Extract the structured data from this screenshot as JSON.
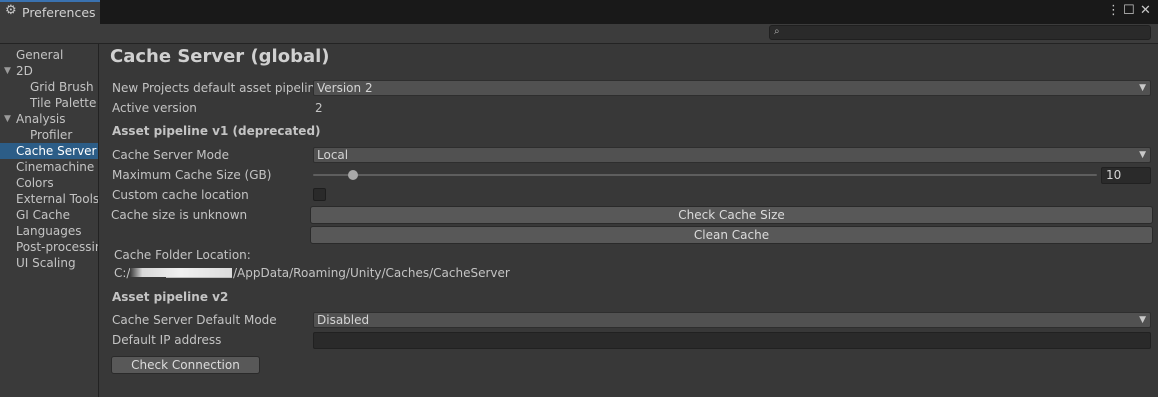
{
  "window": {
    "tab_title": "Preferences",
    "gear_icon": "gear-icon",
    "menu_icon": "⋮",
    "maximize_icon": "☐",
    "close_icon": "✕"
  },
  "search": {
    "placeholder": "",
    "value": ""
  },
  "sidebar": {
    "items": [
      {
        "label": "General",
        "indent": 0
      },
      {
        "label": "2D",
        "indent": 0,
        "foldout": "expanded"
      },
      {
        "label": "Grid Brush",
        "indent": 1
      },
      {
        "label": "Tile Palette",
        "indent": 1
      },
      {
        "label": "Analysis",
        "indent": 0,
        "foldout": "expanded"
      },
      {
        "label": "Profiler",
        "indent": 1
      },
      {
        "label": "Cache Server (",
        "indent": 0,
        "selected": true
      },
      {
        "label": "Cinemachine",
        "indent": 0
      },
      {
        "label": "Colors",
        "indent": 0
      },
      {
        "label": "External Tools",
        "indent": 0
      },
      {
        "label": "GI Cache",
        "indent": 0
      },
      {
        "label": "Languages",
        "indent": 0
      },
      {
        "label": "Post-processing",
        "indent": 0
      },
      {
        "label": "UI Scaling",
        "indent": 0
      }
    ]
  },
  "main": {
    "title": "Cache Server (global)",
    "default_pipeline_label": "New Projects default asset pipeline",
    "default_pipeline_value": "Version 2",
    "active_version_label": "Active version",
    "active_version_value": "2",
    "v1_header": "Asset pipeline v1 (deprecated)",
    "mode_label": "Cache Server Mode",
    "mode_value": "Local",
    "max_size_label": "Maximum Cache Size (GB)",
    "max_size_value": "10",
    "max_size_slider_fraction": 0.02,
    "custom_location_label": "Custom cache location",
    "custom_location_checked": false,
    "size_unknown_label": "Cache size is unknown",
    "check_size_button": "Check Cache Size",
    "clean_cache_button": "Clean Cache",
    "folder_location_label": "Cache Folder Location:",
    "folder_prefix": "C:/",
    "folder_suffix": "/AppData/Roaming/Unity/Caches/CacheServer",
    "v2_header": "Asset pipeline v2",
    "default_mode_label": "Cache Server Default Mode",
    "default_mode_value": "Disabled",
    "ip_label": "Default IP address",
    "ip_value": "",
    "check_connection_button": "Check Connection"
  },
  "colors": {
    "background": "#383838",
    "selection": "#2c5d87",
    "tab_accent": "#3a72b0"
  }
}
